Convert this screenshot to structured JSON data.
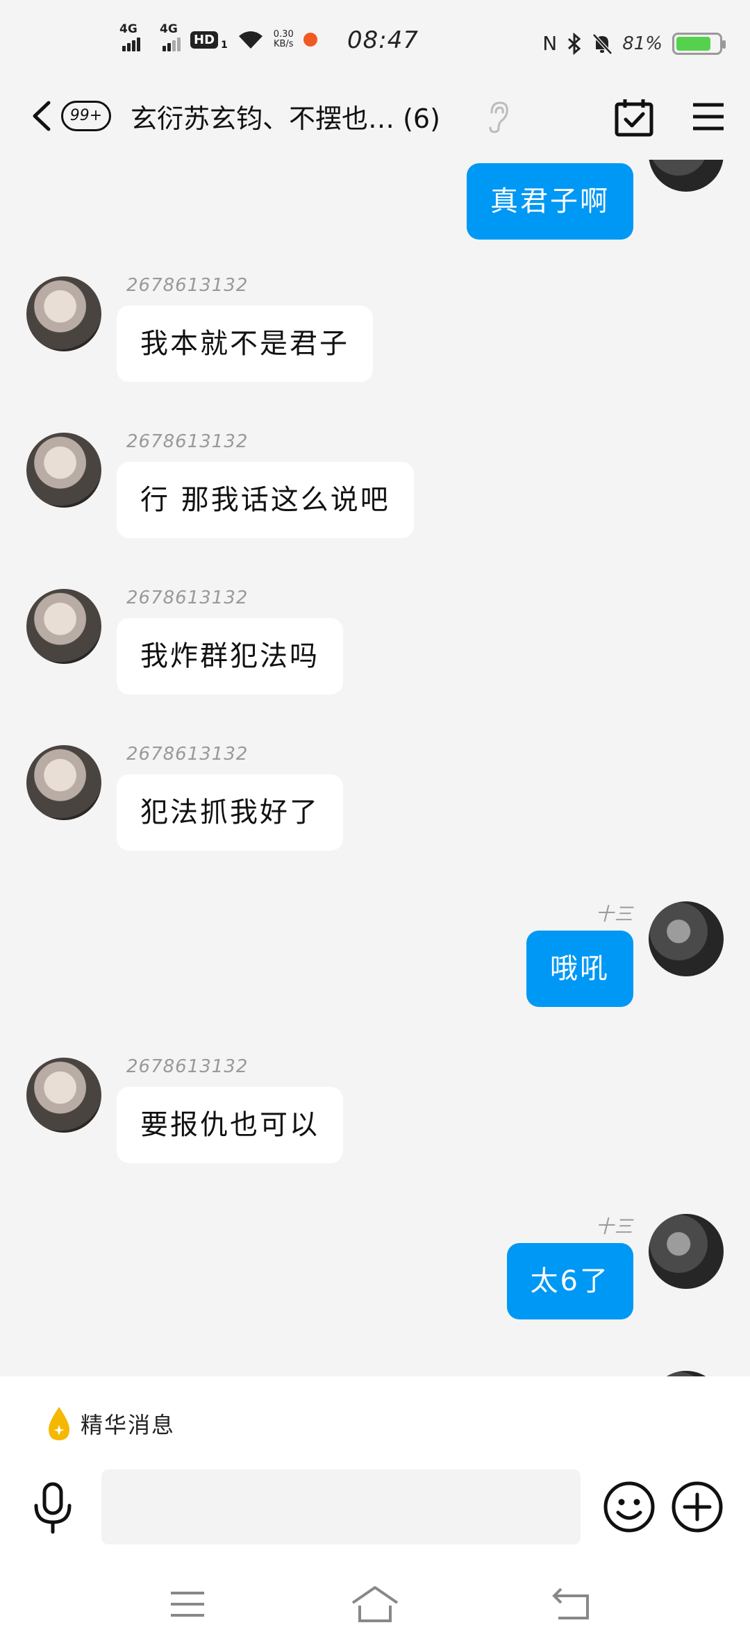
{
  "status_bar": {
    "signal1_label": "4G",
    "signal2_label": "4G",
    "hd_label": "HD",
    "hd_sub": "1",
    "net_speed_value": "0.30",
    "net_speed_unit": "KB/s",
    "time": "08:47",
    "battery_percent": "81%",
    "battery_level": 0.81,
    "battery_color": "#55d14e",
    "icons": [
      "nfc-icon",
      "bluetooth-icon",
      "mute-bell-icon"
    ]
  },
  "header": {
    "unread_badge": "99+",
    "title": "玄衍苏玄钧、不摆也… (6)"
  },
  "messages": [
    {
      "side": "me",
      "sender": "",
      "text": "真君子啊"
    },
    {
      "side": "them",
      "sender": "2678613132",
      "text": "我本就不是君子"
    },
    {
      "side": "them",
      "sender": "2678613132",
      "text": "行 那我话这么说吧"
    },
    {
      "side": "them",
      "sender": "2678613132",
      "text": "我炸群犯法吗"
    },
    {
      "side": "them",
      "sender": "2678613132",
      "text": "犯法抓我好了"
    },
    {
      "side": "me",
      "sender": "十三",
      "text": "哦吼"
    },
    {
      "side": "them",
      "sender": "2678613132",
      "text": "要报仇也可以"
    },
    {
      "side": "me",
      "sender": "十三",
      "text": "太6了"
    }
  ],
  "bottom": {
    "essence_label": "精华消息",
    "input_value": "",
    "input_placeholder": ""
  },
  "colors": {
    "my_bubble": "#0098f5",
    "their_bubble": "#ffffff",
    "chat_background": "#f4f4f4"
  }
}
